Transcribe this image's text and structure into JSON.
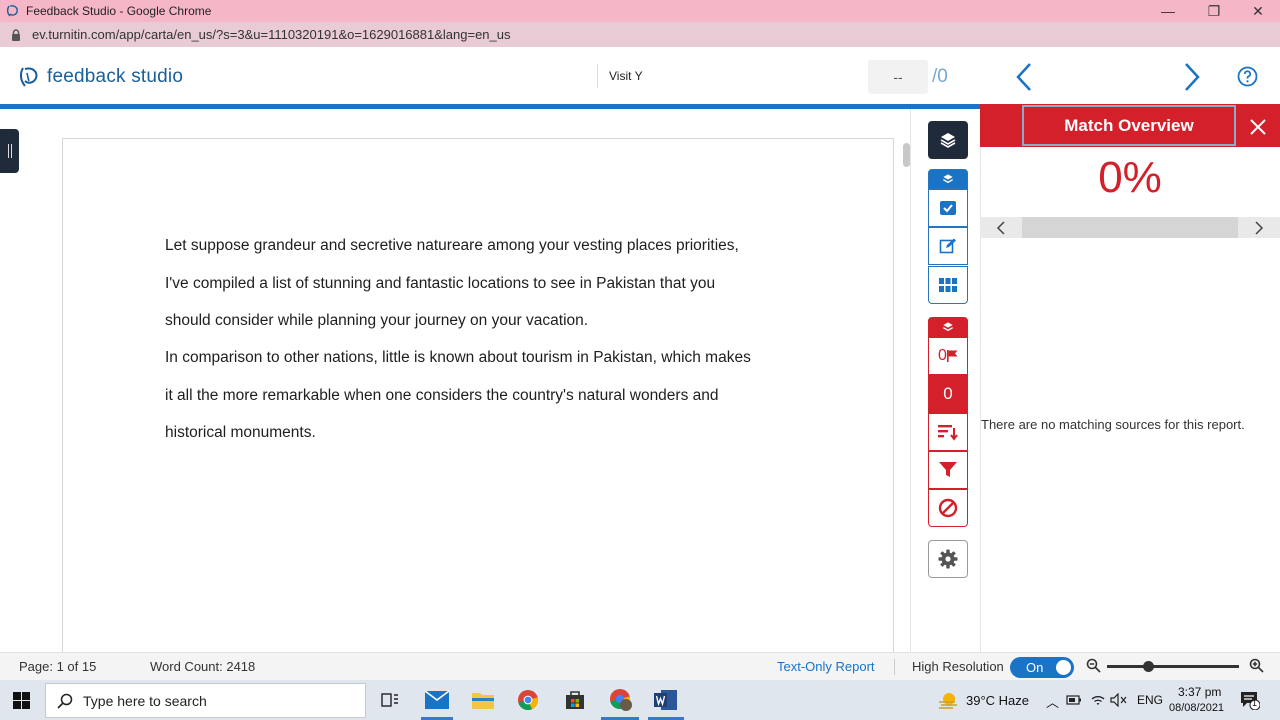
{
  "browser": {
    "window_title": "Feedback Studio - Google Chrome",
    "url": "ev.turnitin.com/app/carta/en_us/?s=3&u=1110320191&o=1629016881&lang=en_us",
    "minimize": "—",
    "restore": "❐",
    "close": "✕"
  },
  "header": {
    "brand": "feedback studio",
    "doc_title": "Visit Y",
    "page_current": "--",
    "page_total": "/0"
  },
  "document": {
    "paragraphs": [
      [
        "Let suppose grandeur and secretive natureare among your vesting places priorities,",
        "I've compiled a list of stunning and fantastic locations to see in Pakistan that you",
        "should consider while planning your journey on your vacation."
      ],
      [
        "In comparison to other nations, little is known about tourism in Pakistan, which makes",
        "it all the more remarkable when one considers the country's natural wonders and",
        "historical monuments."
      ]
    ]
  },
  "tools": {
    "flag_count": "0",
    "match_count": "0"
  },
  "match_overview": {
    "title": "Match Overview",
    "percent": "0%",
    "empty_message": "There are no matching sources for this report."
  },
  "status": {
    "page": "Page: 1 of 15",
    "word_count": "Word Count: 2418",
    "text_only": "Text-Only Report",
    "high_res": "High Resolution",
    "toggle": "On"
  },
  "taskbar": {
    "search_placeholder": "Type here to search",
    "weather": "39°C  Haze",
    "lang": "ENG",
    "time": "3:37 pm",
    "date": "08/08/2021",
    "notif_count": "1"
  },
  "colors": {
    "turnitin_blue": "#1a73c4",
    "brand_text": "#1a5e98",
    "match_red": "#d3202a",
    "tool_dark": "#1f2b3a"
  }
}
